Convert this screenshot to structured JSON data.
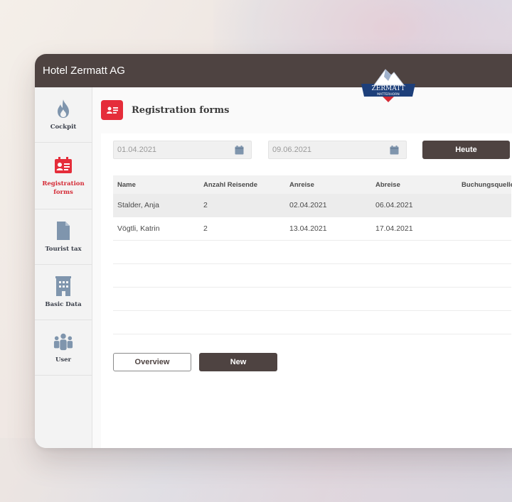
{
  "window": {
    "title": "Hotel Zermatt AG",
    "logo_text": "ZERMATT",
    "logo_subtext": "MATTERHORN"
  },
  "sidebar": {
    "items": [
      {
        "label": "Cockpit",
        "icon": "flame-icon"
      },
      {
        "label": "Registration forms",
        "icon": "id-card-icon",
        "active": true
      },
      {
        "label": "Tourist tax",
        "icon": "document-icon"
      },
      {
        "label": "Basic Data",
        "icon": "building-icon"
      },
      {
        "label": "User",
        "icon": "users-icon"
      }
    ]
  },
  "page": {
    "title": "Registration forms",
    "date_from": "01.04.2021",
    "date_to": "09.06.2021",
    "today_button": "Heute"
  },
  "table": {
    "columns": [
      "Name",
      "Anzahl Reisende",
      "Anreise",
      "Abreise",
      "Buchungsquelle"
    ],
    "rows": [
      {
        "name": "Stalder, Anja",
        "travellers": "2",
        "arrival": "02.04.2021",
        "departure": "06.04.2021",
        "source": ""
      },
      {
        "name": "Vögtli, Katrin",
        "travellers": "2",
        "arrival": "13.04.2021",
        "departure": "17.04.2021",
        "source": ""
      }
    ]
  },
  "actions": {
    "overview": "Overview",
    "new": "New"
  },
  "colors": {
    "titlebar": "#4e4341",
    "accent": "#e52d3a",
    "icon_blue": "#7f95ad"
  }
}
